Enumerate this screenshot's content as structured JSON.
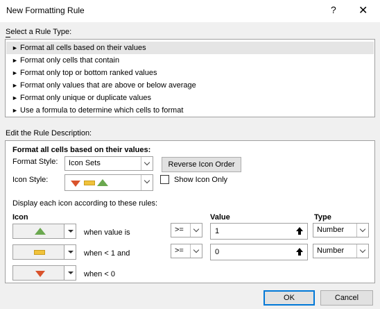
{
  "window": {
    "title": "New Formatting Rule",
    "help_glyph": "?",
    "close_glyph": "✕"
  },
  "rule_type": {
    "label": "Select a Rule Type:",
    "items": [
      "Format all cells based on their values",
      "Format only cells that contain",
      "Format only top or bottom ranked values",
      "Format only values that are above or below average",
      "Format only unique or duplicate values",
      "Use a formula to determine which cells to format"
    ],
    "selected_index": 0
  },
  "description": {
    "label": "Edit the Rule Description:",
    "heading": "Format all cells based on their values:",
    "format_style_label": "Format Style:",
    "format_style_value": "Icon Sets",
    "reverse_button": "Reverse Icon Order",
    "icon_style_label": "Icon Style:",
    "show_icon_only_label": "Show Icon Only",
    "show_icon_only_checked": false,
    "rules_caption": "Display each icon according to these rules:",
    "col_icon": "Icon",
    "col_value": "Value",
    "col_type": "Type",
    "rows": [
      {
        "icon": "green-triangle-up-icon",
        "condition": "when value is",
        "operator": ">=",
        "value": "1",
        "type": "Number"
      },
      {
        "icon": "yellow-bar-icon",
        "condition": "when < 1 and",
        "operator": ">=",
        "value": "0",
        "type": "Number"
      },
      {
        "icon": "red-triangle-down-icon",
        "condition": "when < 0"
      }
    ]
  },
  "footer": {
    "ok": "OK",
    "cancel": "Cancel"
  },
  "colors": {
    "green": "#6aa84f",
    "yellow": "#f0c23b",
    "red": "#d9532c",
    "accent": "#0078d7"
  }
}
